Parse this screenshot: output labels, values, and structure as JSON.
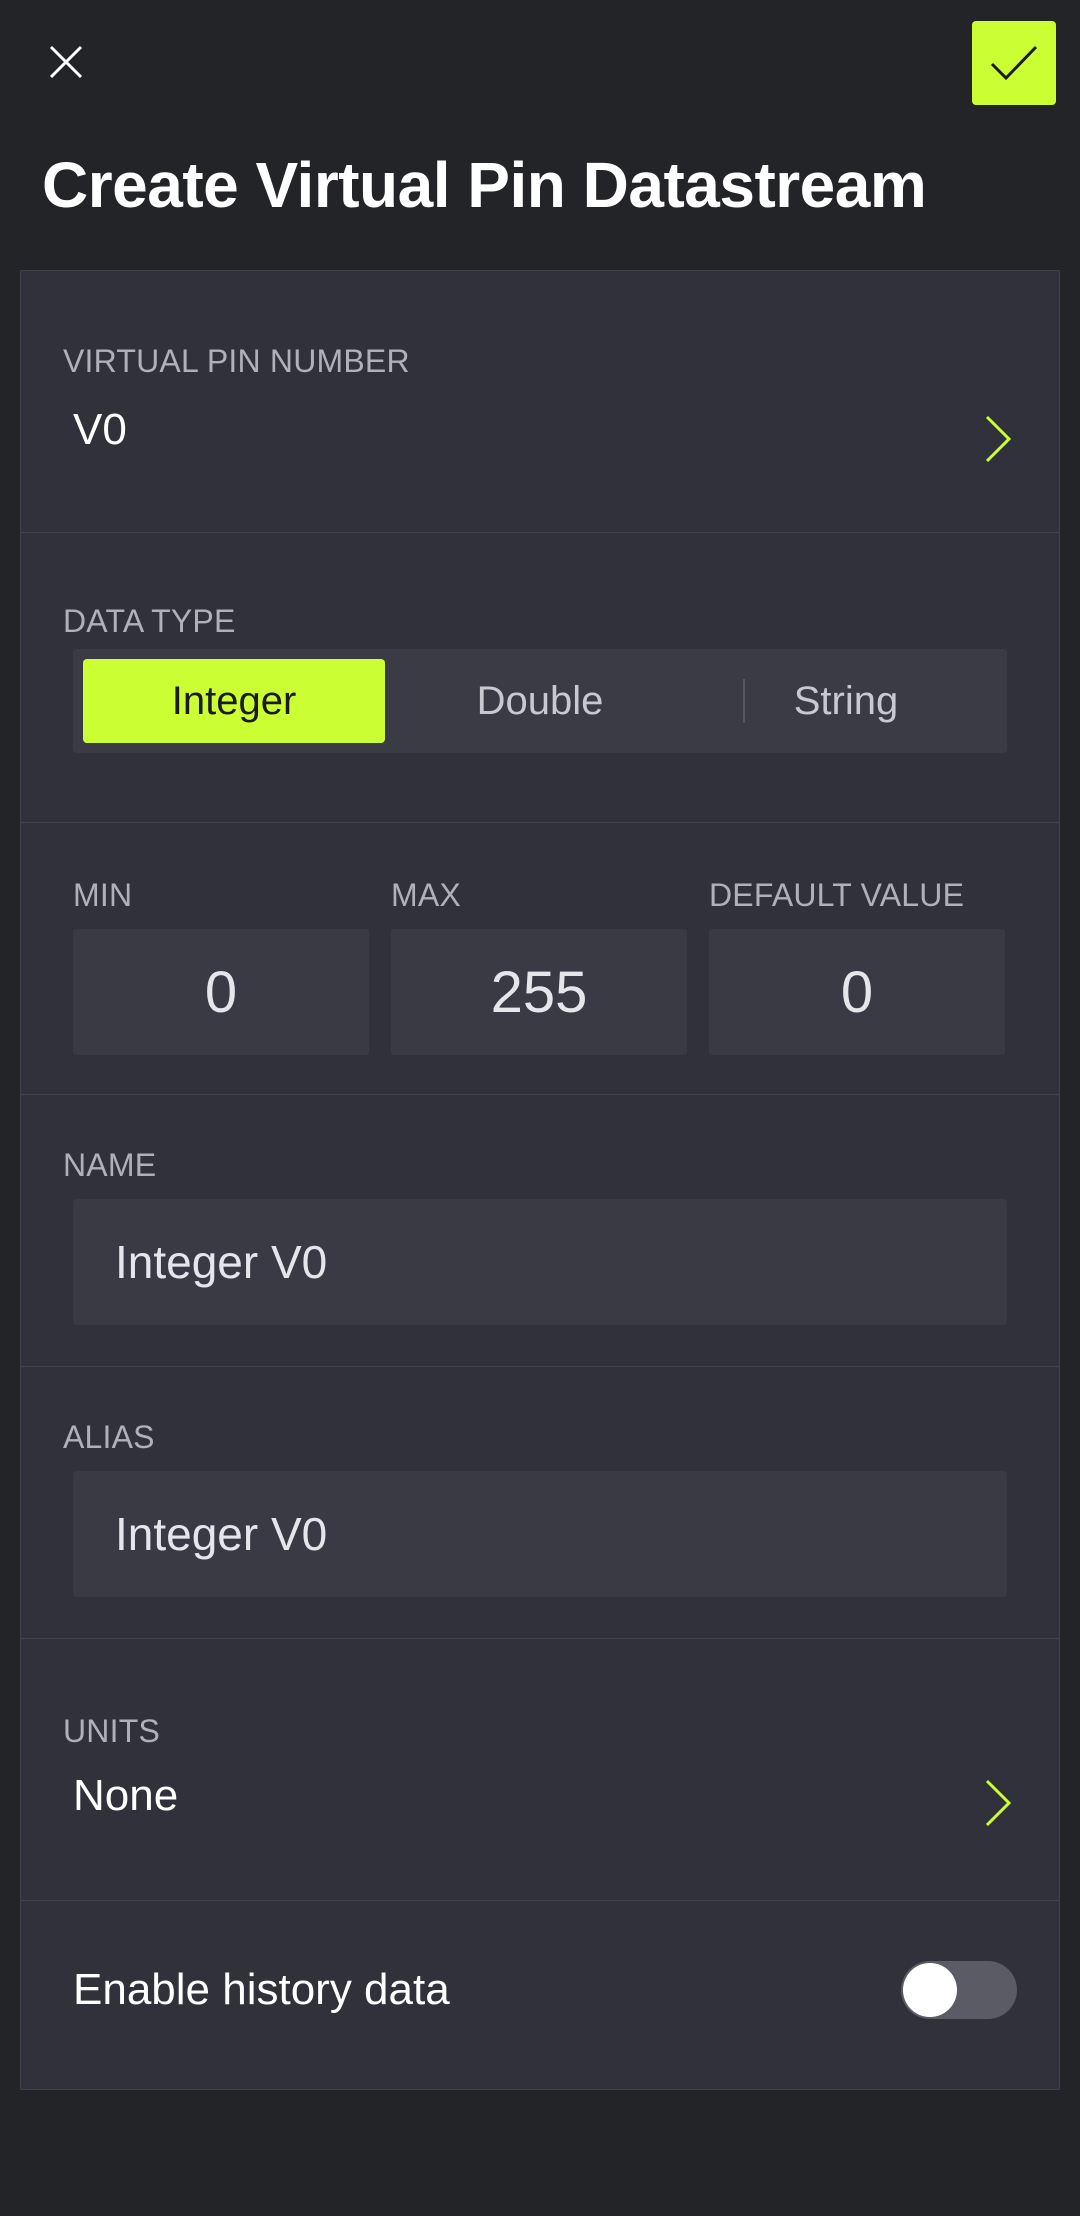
{
  "header": {
    "title": "Create Virtual Pin Datastream",
    "close_icon": "close-icon",
    "confirm_icon": "checkmark-icon",
    "accent_color": "#ccff33"
  },
  "virtual_pin": {
    "label": "VIRTUAL PIN NUMBER",
    "value": "V0",
    "icon": "chevron-right-icon"
  },
  "data_type": {
    "label": "DATA TYPE",
    "options": [
      "Integer",
      "Double",
      "String"
    ],
    "selected": "Integer"
  },
  "range": {
    "min_label": "MIN",
    "min_value": "0",
    "max_label": "MAX",
    "max_value": "255",
    "default_label": "DEFAULT VALUE",
    "default_value": "0"
  },
  "name": {
    "label": "NAME",
    "value": "Integer V0"
  },
  "alias": {
    "label": "ALIAS",
    "value": "Integer V0"
  },
  "units": {
    "label": "UNITS",
    "value": "None",
    "icon": "chevron-right-icon"
  },
  "history": {
    "label": "Enable history data",
    "enabled": false
  }
}
